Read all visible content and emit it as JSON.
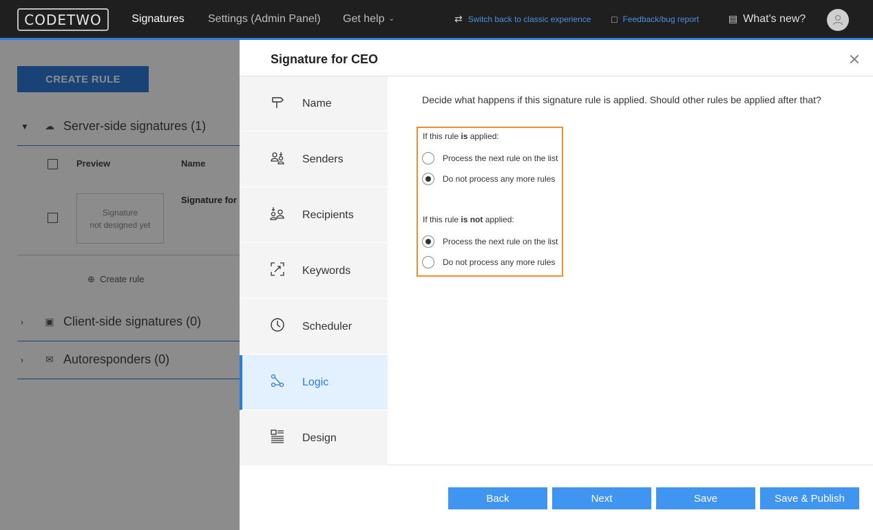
{
  "header": {
    "logo": "CODETWO",
    "nav": [
      "Signatures",
      "Settings (Admin Panel)",
      "Get help"
    ],
    "switch_link": "Switch back to classic experience",
    "feedback_link": "Feedback/bug report",
    "whats_new": "What's new?"
  },
  "background": {
    "create_rule_button": "CREATE RULE",
    "sections": [
      {
        "label": "Server-side signatures (1)"
      },
      {
        "label": "Client-side signatures (0)"
      },
      {
        "label": "Autoresponders (0)"
      }
    ],
    "columns": {
      "preview": "Preview",
      "name": "Name"
    },
    "row": {
      "preview_placeholder_1": "Signature",
      "preview_placeholder_2": "not designed yet",
      "name": "Signature for"
    },
    "create_rule_link": "Create rule"
  },
  "modal": {
    "title": "Signature for CEO",
    "steps": [
      {
        "label": "Name",
        "icon": "signpost-icon"
      },
      {
        "label": "Senders",
        "icon": "senders-icon"
      },
      {
        "label": "Recipients",
        "icon": "recipients-icon"
      },
      {
        "label": "Keywords",
        "icon": "keywords-icon"
      },
      {
        "label": "Scheduler",
        "icon": "clock-icon"
      },
      {
        "label": "Logic",
        "icon": "logic-icon",
        "active": true
      },
      {
        "label": "Design",
        "icon": "design-icon"
      }
    ],
    "question": "Decide what happens if this signature rule is applied. Should other rules be applied after that?",
    "group_applied": {
      "prefix": "If this rule ",
      "bold": "is",
      "suffix": " applied:"
    },
    "group_not_applied": {
      "prefix": "If this rule ",
      "bold": "is not",
      "suffix": " applied:"
    },
    "options": {
      "process_next": "Process the next rule on the list",
      "do_not_process": "Do not process any more rules"
    },
    "applied_selected": "do_not_process",
    "not_applied_selected": "process_next",
    "buttons": {
      "back": "Back",
      "next": "Next",
      "save": "Save",
      "save_publish": "Save & Publish"
    }
  },
  "colors": {
    "accent": "#2f7bd8",
    "button": "#3f95f0",
    "highlight": "#f28c28",
    "topbar": "#1f1f1f"
  }
}
